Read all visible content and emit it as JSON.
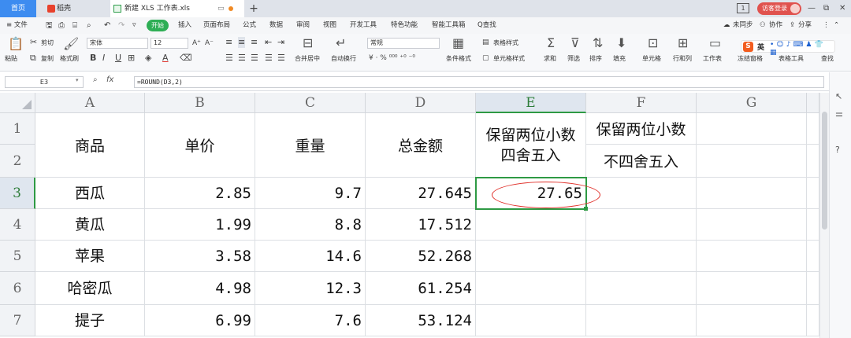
{
  "tabs": {
    "home": "首页",
    "daoke": "稻壳",
    "document": "新建 XLS 工作表.xls",
    "new_tab": "+"
  },
  "window": {
    "visitor_label": "访客登录",
    "minimize": "—",
    "restore": "⧉",
    "close": "✕",
    "badge": "1"
  },
  "menu": {
    "file": "≡ 文件",
    "start": "开始",
    "items": [
      "插入",
      "页面布局",
      "公式",
      "数据",
      "审阅",
      "视图",
      "开发工具",
      "特色功能",
      "智能工具箱"
    ],
    "search": "Q查找",
    "sync": "未同步",
    "collab": "协作",
    "share": "分享"
  },
  "ribbon": {
    "paste": "粘贴",
    "cut": "剪切",
    "copy": "复制",
    "format_painter": "格式刷",
    "font_name": "宋体",
    "font_size": "12",
    "bold": "B",
    "italic": "I",
    "underline": "U",
    "merge_center": "合并居中",
    "wrap": "自动换行",
    "number_format": "常规",
    "conditional_format": "条件格式",
    "table_style": "表格样式",
    "cell_style": "单元格样式",
    "sum": "求和",
    "filter": "筛选",
    "sort": "排序",
    "fill": "填充",
    "cells": "单元格",
    "row_col": "行和列",
    "worksheet": "工作表",
    "freeze": "冻结窗格",
    "table_tools": "表格工具",
    "find": "查找",
    "ime": "英"
  },
  "formula_bar": {
    "name_box": "E3",
    "fx": "fx",
    "formula": "=ROUND(D3,2)"
  },
  "sheet": {
    "columns": [
      "A",
      "B",
      "C",
      "D",
      "E",
      "F",
      "G"
    ],
    "rows": [
      "1",
      "2",
      "3",
      "4",
      "5",
      "6",
      "7"
    ],
    "headers": {
      "a": "商品",
      "b": "单价",
      "c": "重量",
      "d": "总金额",
      "e_line1": "保留两位小数",
      "e_line2": "四舍五入",
      "f_line1": "保留两位小数",
      "f_line2": "不四舍五入"
    },
    "data": [
      {
        "name": "西瓜",
        "price": "2.85",
        "weight": "9.7",
        "total": "27.645",
        "rounded": "27.65"
      },
      {
        "name": "黄瓜",
        "price": "1.99",
        "weight": "8.8",
        "total": "17.512",
        "rounded": ""
      },
      {
        "name": "苹果",
        "price": "3.58",
        "weight": "14.6",
        "total": "52.268",
        "rounded": ""
      },
      {
        "name": "哈密瓜",
        "price": "4.98",
        "weight": "12.3",
        "total": "61.254",
        "rounded": ""
      },
      {
        "name": "提子",
        "price": "6.99",
        "weight": "7.6",
        "total": "53.124",
        "rounded": ""
      }
    ]
  },
  "colors": {
    "selection": "#2e9a44",
    "annotation": "#e0302a",
    "home_tab": "#3d8cf0",
    "start_pill": "#2eae55"
  }
}
